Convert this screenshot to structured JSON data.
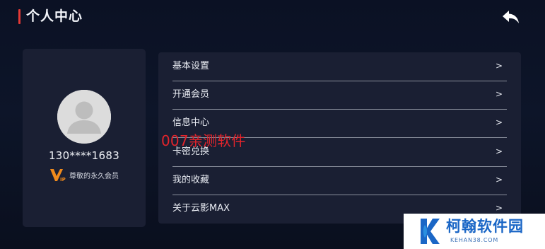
{
  "header": {
    "title": "个人中心",
    "back_icon": "back-arrow-icon"
  },
  "profile": {
    "avatar_icon": "default-avatar-icon",
    "phone": "130****1683",
    "vip_icon": "vip-badge-icon",
    "vip_icon_text": "VIP",
    "vip_label": "尊敬的永久会员"
  },
  "menu": {
    "items": [
      {
        "label": "基本设置",
        "chevron": ">"
      },
      {
        "label": "开通会员",
        "chevron": ">"
      },
      {
        "label": "信息中心",
        "chevron": ">"
      },
      {
        "label": "卡密兑换",
        "chevron": ">"
      },
      {
        "label": "我的收藏",
        "chevron": ">"
      },
      {
        "label": "关于云影MAX",
        "chevron": ">"
      }
    ]
  },
  "watermark": {
    "text": "007亲测软件"
  },
  "site_badge": {
    "name": "柯翰软件园",
    "url": "KEHAN38.COM",
    "logo_icon": "k-logo-icon"
  },
  "colors": {
    "background": "#0d1529",
    "card": "#1a1f33",
    "accent_red": "#e53935",
    "vip_orange": "#f08a1c",
    "site_blue": "#1a66c6"
  }
}
